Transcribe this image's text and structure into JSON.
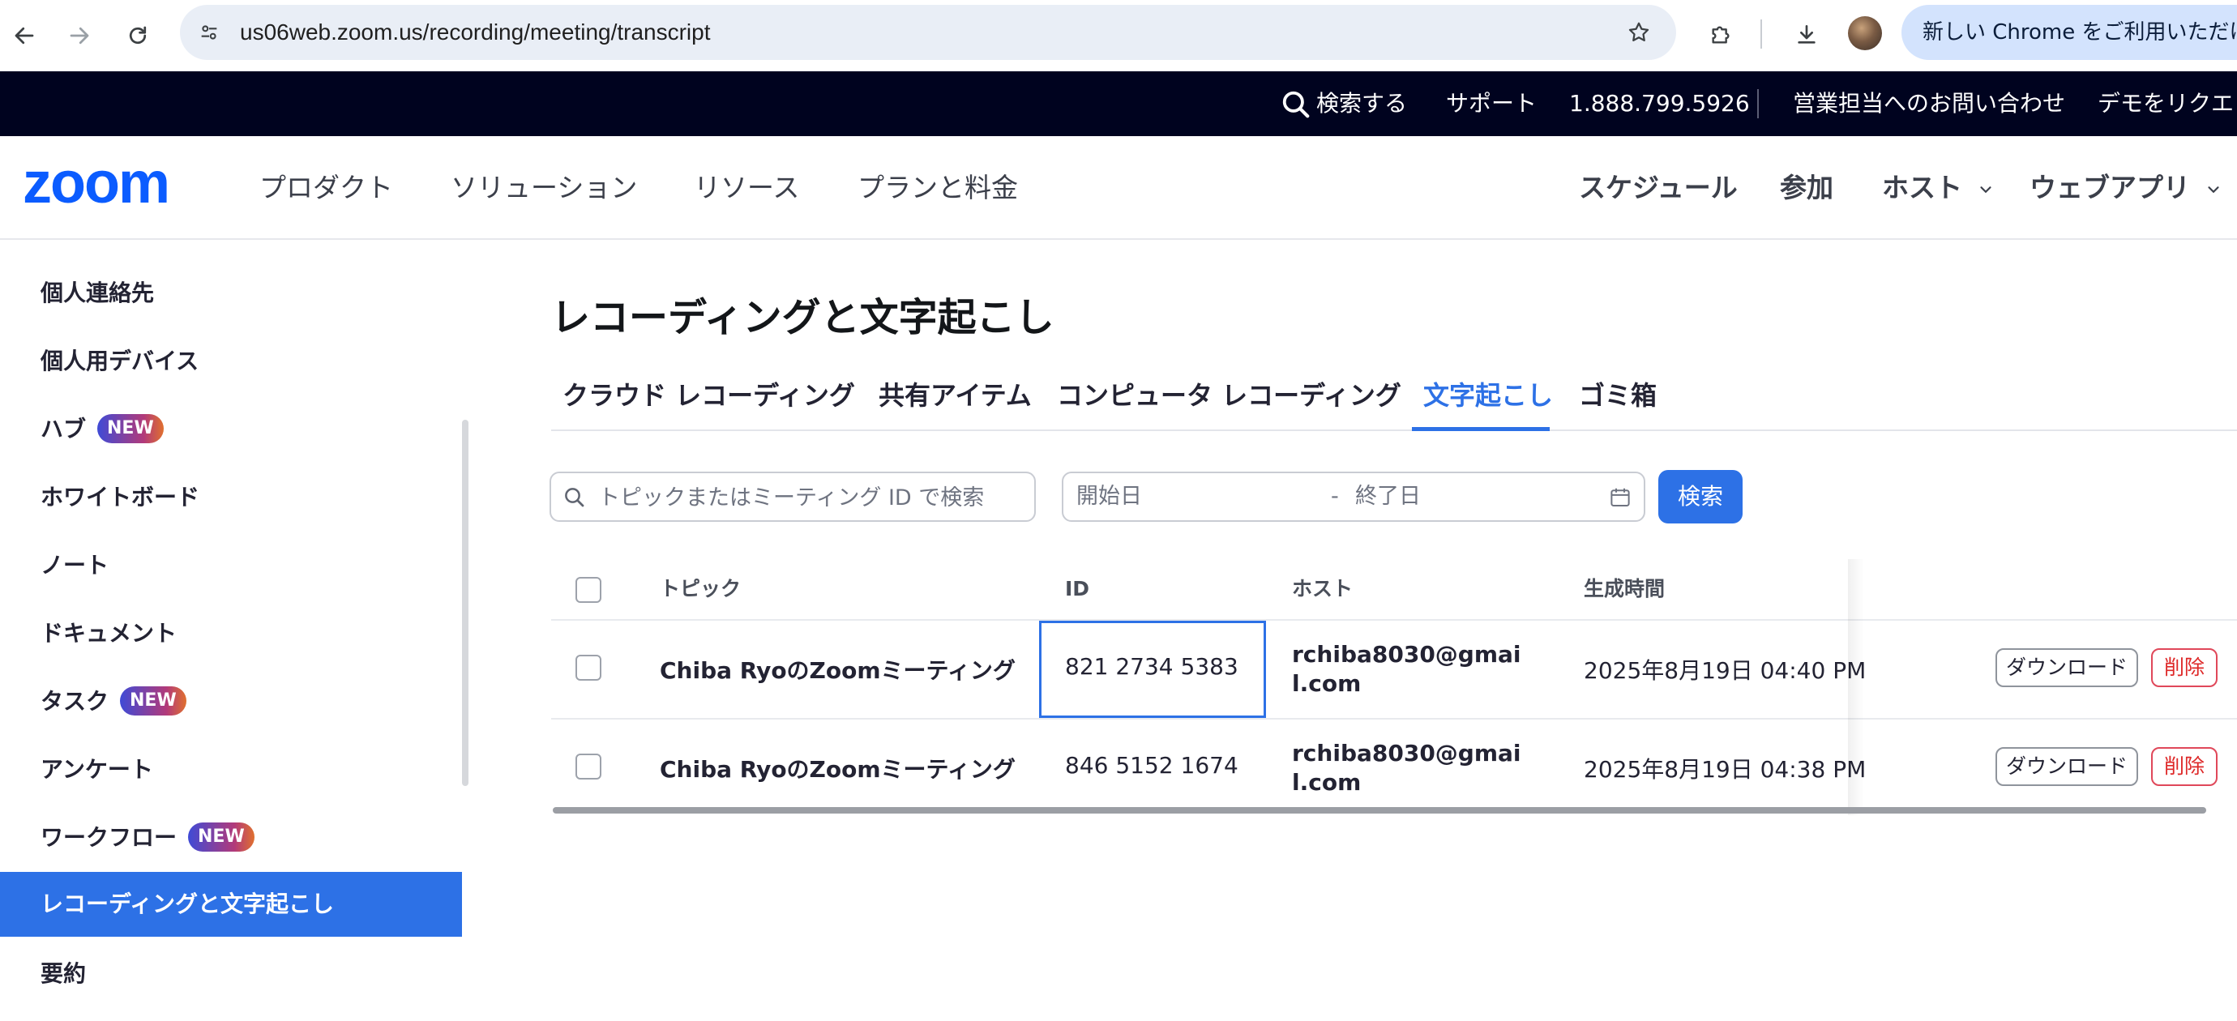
{
  "browser": {
    "url": "us06web.zoom.us/recording/meeting/transcript",
    "promo_text": "新しい Chrome をご利用いただけま"
  },
  "topbar": {
    "search": "検索する",
    "support": "サポート",
    "phone": "1.888.799.5926",
    "contact_sales": "営業担当へのお問い合わせ",
    "request_demo": "デモをリクエ"
  },
  "mainnav": {
    "logo": "zoom",
    "items": [
      "プロダクト",
      "ソリューション",
      "リソース",
      "プランと料金"
    ],
    "schedule": "スケジュール",
    "join": "参加",
    "host": "ホスト",
    "webapp": "ウェブアプリ"
  },
  "sidebar": {
    "items": [
      {
        "label": "個人連絡先",
        "badge": ""
      },
      {
        "label": "個人用デバイス",
        "badge": ""
      },
      {
        "label": "ハブ",
        "badge": "NEW"
      },
      {
        "label": "ホワイトボード",
        "badge": ""
      },
      {
        "label": "ノート",
        "badge": ""
      },
      {
        "label": "ドキュメント",
        "badge": ""
      },
      {
        "label": "タスク",
        "badge": "NEW"
      },
      {
        "label": "アンケート",
        "badge": ""
      },
      {
        "label": "ワークフロー",
        "badge": "NEW"
      },
      {
        "label": "レコーディングと文字起こし",
        "badge": "",
        "active": true
      },
      {
        "label": "要約",
        "badge": ""
      }
    ]
  },
  "page": {
    "title": "レコーディングと文字起こし",
    "tabs": [
      "クラウド レコーディング",
      "共有アイテム",
      "コンピュータ レコーディング",
      "文字起こし",
      "ゴミ箱"
    ],
    "active_tab": "文字起こし",
    "search_placeholder": "トピックまたはミーティング ID で検索",
    "start_date": "開始日",
    "date_dash": "-",
    "end_date": "終了日",
    "search_button": "検索"
  },
  "table": {
    "headers": {
      "topic": "トピック",
      "id": "ID",
      "host": "ホスト",
      "created": "生成時間"
    },
    "rows": [
      {
        "topic": "Chiba RyoのZoomミーティング",
        "id": "821 2734 5383",
        "host": "rchiba8030@gmail.com",
        "created": "2025年8月19日 04:40 PM",
        "download": "ダウンロード",
        "delete": "削除"
      },
      {
        "topic": "Chiba RyoのZoomミーティング",
        "id": "846 5152 1674",
        "host": "rchiba8030@gmail.com",
        "created": "2025年8月19日 04:38 PM",
        "download": "ダウンロード",
        "delete": "削除"
      }
    ]
  },
  "colors": {
    "zoom_blue": "#0b5cff",
    "accent": "#2d71e6",
    "topbar_bg": "#00031f",
    "delete_red": "#de2828"
  }
}
